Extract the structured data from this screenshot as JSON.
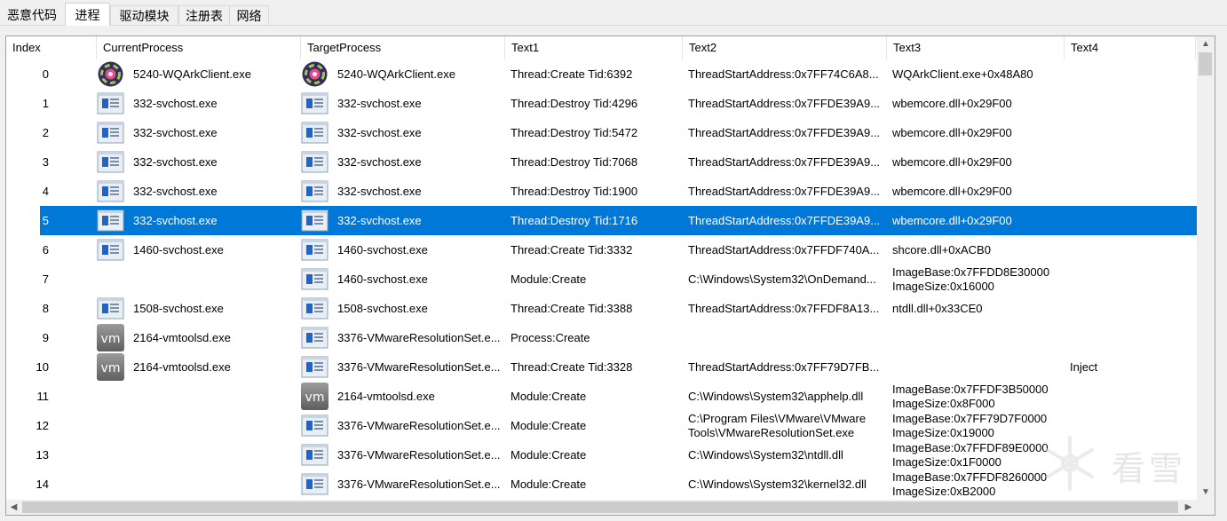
{
  "tabs": [
    {
      "label": "恶意代码",
      "active": false
    },
    {
      "label": "进程",
      "active": true
    },
    {
      "label": "驱动模块",
      "active": false
    },
    {
      "label": "注册表",
      "active": false
    },
    {
      "label": "网络",
      "active": false
    }
  ],
  "columns": [
    "Index",
    "CurrentProcess",
    "TargetProcess",
    "Text1",
    "Text2",
    "Text3",
    "Text4"
  ],
  "rows": [
    {
      "index": "0",
      "cur_icon": "wqark-app-icon",
      "current": "5240-WQArkClient.exe",
      "tgt_icon": "wqark-app-icon",
      "target": "5240-WQArkClient.exe",
      "text1": "Thread:Create Tid:6392",
      "text2": "ThreadStartAddress:0x7FF74C6A8...",
      "text3": "WQArkClient.exe+0x48A80",
      "text4": ""
    },
    {
      "index": "1",
      "cur_icon": "window-app-icon",
      "current": "332-svchost.exe",
      "tgt_icon": "window-app-icon",
      "target": "332-svchost.exe",
      "text1": "Thread:Destroy Tid:4296",
      "text2": "ThreadStartAddress:0x7FFDE39A9...",
      "text3": "wbemcore.dll+0x29F00",
      "text4": ""
    },
    {
      "index": "2",
      "cur_icon": "window-app-icon",
      "current": "332-svchost.exe",
      "tgt_icon": "window-app-icon",
      "target": "332-svchost.exe",
      "text1": "Thread:Destroy Tid:5472",
      "text2": "ThreadStartAddress:0x7FFDE39A9...",
      "text3": "wbemcore.dll+0x29F00",
      "text4": ""
    },
    {
      "index": "3",
      "cur_icon": "window-app-icon",
      "current": "332-svchost.exe",
      "tgt_icon": "window-app-icon",
      "target": "332-svchost.exe",
      "text1": "Thread:Destroy Tid:7068",
      "text2": "ThreadStartAddress:0x7FFDE39A9...",
      "text3": "wbemcore.dll+0x29F00",
      "text4": ""
    },
    {
      "index": "4",
      "cur_icon": "window-app-icon",
      "current": "332-svchost.exe",
      "tgt_icon": "window-app-icon",
      "target": "332-svchost.exe",
      "text1": "Thread:Destroy Tid:1900",
      "text2": "ThreadStartAddress:0x7FFDE39A9...",
      "text3": "wbemcore.dll+0x29F00",
      "text4": ""
    },
    {
      "index": "5",
      "cur_icon": "window-app-icon",
      "current": "332-svchost.exe",
      "tgt_icon": "window-app-icon",
      "target": "332-svchost.exe",
      "text1": "Thread:Destroy Tid:1716",
      "text2": "ThreadStartAddress:0x7FFDE39A9...",
      "text3": "wbemcore.dll+0x29F00",
      "text4": "",
      "selected": true
    },
    {
      "index": "6",
      "cur_icon": "window-app-icon",
      "current": "1460-svchost.exe",
      "tgt_icon": "window-app-icon",
      "target": "1460-svchost.exe",
      "text1": "Thread:Create Tid:3332",
      "text2": "ThreadStartAddress:0x7FFDF740A...",
      "text3": "shcore.dll+0xACB0",
      "text4": ""
    },
    {
      "index": "7",
      "cur_icon": "",
      "current": "",
      "tgt_icon": "window-app-icon",
      "target": "1460-svchost.exe",
      "text1": "Module:Create",
      "text2": "C:\\Windows\\System32\\OnDemand...",
      "text3": "ImageBase:0x7FFDD8E30000\nImageSize:0x16000",
      "text4": ""
    },
    {
      "index": "8",
      "cur_icon": "window-app-icon",
      "current": "1508-svchost.exe",
      "tgt_icon": "window-app-icon",
      "target": "1508-svchost.exe",
      "text1": "Thread:Create Tid:3388",
      "text2": "ThreadStartAddress:0x7FFDF8A13...",
      "text3": "ntdll.dll+0x33CE0",
      "text4": ""
    },
    {
      "index": "9",
      "cur_icon": "vm-icon",
      "current": "2164-vmtoolsd.exe",
      "tgt_icon": "window-app-icon",
      "target": "3376-VMwareResolutionSet.e...",
      "text1": "Process:Create",
      "text2": "",
      "text3": "",
      "text4": ""
    },
    {
      "index": "10",
      "cur_icon": "vm-icon",
      "current": "2164-vmtoolsd.exe",
      "tgt_icon": "window-app-icon",
      "target": "3376-VMwareResolutionSet.e...",
      "text1": "Thread:Create Tid:3328",
      "text2": "ThreadStartAddress:0x7FF79D7FB...",
      "text3": "",
      "text4": "Inject"
    },
    {
      "index": "11",
      "cur_icon": "",
      "current": "",
      "tgt_icon": "vm-icon",
      "target": "2164-vmtoolsd.exe",
      "text1": "Module:Create",
      "text2": "C:\\Windows\\System32\\apphelp.dll",
      "text3": "ImageBase:0x7FFDF3B50000\nImageSize:0x8F000",
      "text4": ""
    },
    {
      "index": "12",
      "cur_icon": "",
      "current": "",
      "tgt_icon": "window-app-icon",
      "target": "3376-VMwareResolutionSet.e...",
      "text1": "Module:Create",
      "text2": "C:\\Program Files\\VMware\\VMware\nTools\\VMwareResolutionSet.exe",
      "text3": "ImageBase:0x7FF79D7F0000\nImageSize:0x19000",
      "text4": ""
    },
    {
      "index": "13",
      "cur_icon": "",
      "current": "",
      "tgt_icon": "window-app-icon",
      "target": "3376-VMwareResolutionSet.e...",
      "text1": "Module:Create",
      "text2": "C:\\Windows\\System32\\ntdll.dll",
      "text3": "ImageBase:0x7FFDF89E0000\nImageSize:0x1F0000",
      "text4": ""
    },
    {
      "index": "14",
      "cur_icon": "",
      "current": "",
      "tgt_icon": "window-app-icon",
      "target": "3376-VMwareResolutionSet.e...",
      "text1": "Module:Create",
      "text2": "C:\\Windows\\System32\\kernel32.dll",
      "text3": "ImageBase:0x7FFDF8260000\nImageSize:0xB2000",
      "text4": ""
    }
  ],
  "scrollbar": {
    "up": "▲",
    "down": "▼",
    "left": "◀",
    "right": "▶"
  },
  "watermark": {
    "icon": "snowflake-logo-icon",
    "text": "看雪"
  }
}
